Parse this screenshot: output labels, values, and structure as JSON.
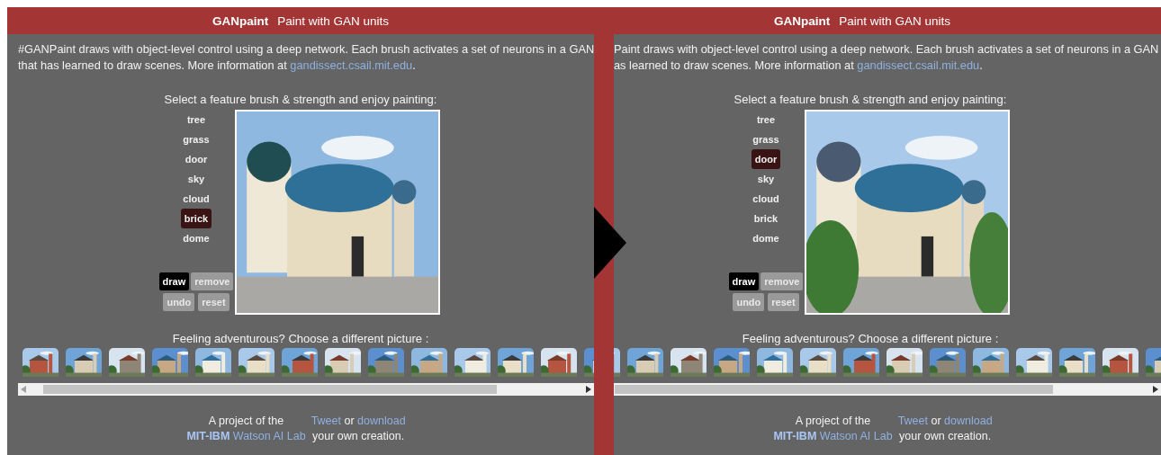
{
  "panels": [
    {
      "header": {
        "brand": "GANpaint",
        "subtitle": "Paint with GAN units"
      },
      "intro": {
        "lines": [
          "#GANPaint draws with object-level control using a deep network. Each brush activates a set of neurons in a GAN",
          "that has learned to draw scenes. More information at "
        ],
        "link": "gandissect.csail.mit.edu",
        "end": "."
      },
      "prompt": "Select a feature brush & strength and enjoy painting:",
      "brushes": [
        {
          "label": "tree",
          "selected": false
        },
        {
          "label": "grass",
          "selected": false
        },
        {
          "label": "door",
          "selected": false
        },
        {
          "label": "sky",
          "selected": false
        },
        {
          "label": "cloud",
          "selected": false
        },
        {
          "label": "brick",
          "selected": true
        },
        {
          "label": "dome",
          "selected": false
        }
      ],
      "modes": [
        {
          "label": "draw",
          "selected": true
        },
        {
          "label": "remove",
          "selected": false
        }
      ],
      "actions": [
        "undo",
        "reset"
      ],
      "gallery": {
        "title": "Feeling adventurous? Choose a different picture :"
      },
      "footer": {
        "project": "A project of the",
        "lab": "**MIT-IBM** Watson AI Lab",
        "tweet": "Tweet",
        "or": " or ",
        "download": "download",
        "end": "your own creation."
      }
    },
    {
      "header": {
        "brand": "GANpaint",
        "subtitle": "Paint with GAN units"
      },
      "intro": {
        "lines": [
          "Paint draws with object-level control using a deep network. Each brush activates a set of neurons in a GAN",
          "as learned to draw scenes. More information at "
        ],
        "link": "gandissect.csail.mit.edu",
        "end": "."
      },
      "prompt": "Select a feature brush & strength and enjoy painting:",
      "brushes": [
        {
          "label": "tree",
          "selected": false
        },
        {
          "label": "grass",
          "selected": false
        },
        {
          "label": "door",
          "selected": true
        },
        {
          "label": "sky",
          "selected": false
        },
        {
          "label": "cloud",
          "selected": false
        },
        {
          "label": "brick",
          "selected": false
        },
        {
          "label": "dome",
          "selected": false
        }
      ],
      "modes": [
        {
          "label": "draw",
          "selected": true
        },
        {
          "label": "remove",
          "selected": false
        }
      ],
      "actions": [
        "undo",
        "reset"
      ],
      "gallery": {
        "title": "Feeling adventurous? Choose a different picture :"
      },
      "footer": {
        "project": "A project of the",
        "lab": "**MIT-IBM** Watson AI Lab",
        "tweet": "Tweet",
        "or": " or ",
        "download": "download",
        "end": "your own creation."
      }
    }
  ]
}
